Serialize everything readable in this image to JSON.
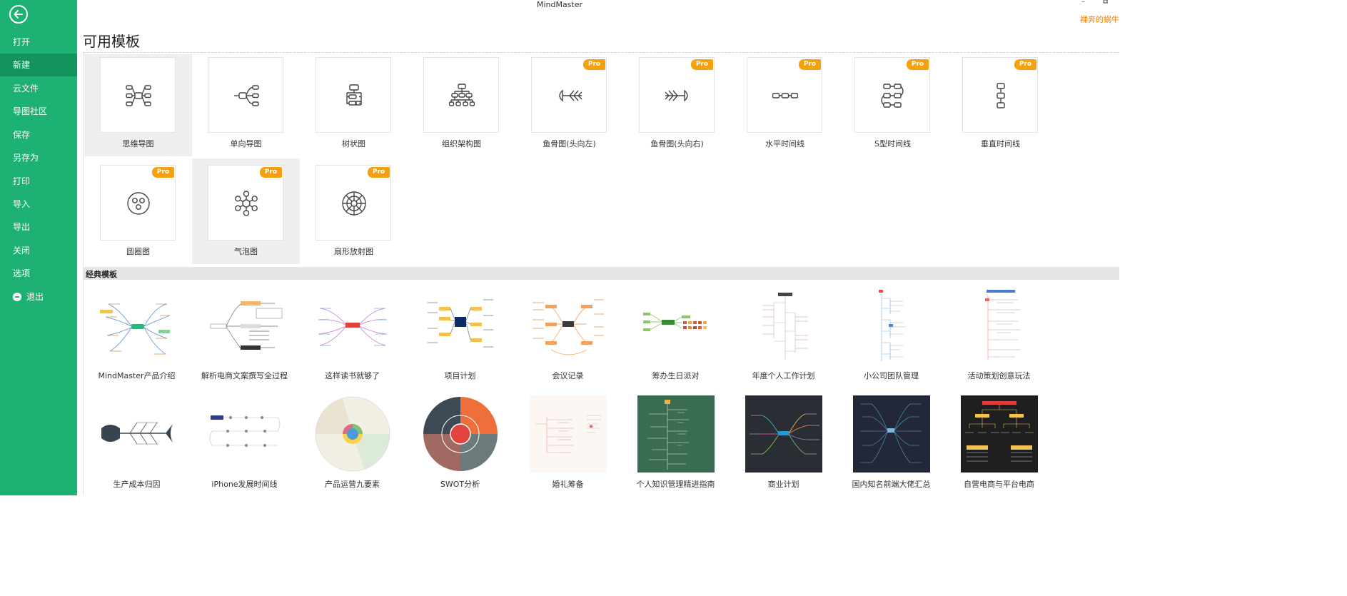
{
  "app": {
    "title": "MindMaster",
    "minimize": "–",
    "restore": "⧉",
    "user": "裸奔的蜗牛"
  },
  "sidebar": {
    "items": [
      {
        "label": "打开"
      },
      {
        "label": "新建"
      },
      {
        "label": "云文件"
      },
      {
        "label": "导图社区"
      },
      {
        "label": "保存"
      },
      {
        "label": "另存为"
      },
      {
        "label": "打印"
      },
      {
        "label": "导入"
      },
      {
        "label": "导出"
      },
      {
        "label": "关闭"
      },
      {
        "label": "选项"
      },
      {
        "label": "退出"
      }
    ],
    "active": "新建"
  },
  "page_title": "可用模板",
  "available_templates": [
    {
      "label": "思维导图",
      "pro": false,
      "icon": "mindmap-icon"
    },
    {
      "label": "单向导图",
      "pro": false,
      "icon": "right-map-icon"
    },
    {
      "label": "树状图",
      "pro": false,
      "icon": "tree-icon"
    },
    {
      "label": "组织架构图",
      "pro": false,
      "icon": "org-chart-icon"
    },
    {
      "label": "鱼骨图(头向左)",
      "pro": true,
      "icon": "fishbone-left-icon"
    },
    {
      "label": "鱼骨图(头向右)",
      "pro": true,
      "icon": "fishbone-right-icon"
    },
    {
      "label": "水平时间线",
      "pro": true,
      "icon": "horizontal-timeline-icon"
    },
    {
      "label": "S型时间线",
      "pro": true,
      "icon": "s-timeline-icon"
    },
    {
      "label": "垂直时间线",
      "pro": true,
      "icon": "vertical-timeline-icon"
    },
    {
      "label": "圆圈图",
      "pro": true,
      "icon": "circle-icon"
    },
    {
      "label": "气泡图",
      "pro": true,
      "icon": "bubble-icon"
    },
    {
      "label": "扇形放射图",
      "pro": true,
      "icon": "sector-icon"
    }
  ],
  "pro_badge": "Pro",
  "section_title": "经典模板",
  "classic_templates": [
    {
      "label": "MindMaster产品介绍",
      "bg": "#ffffff"
    },
    {
      "label": "解析电商文案撰写全过程",
      "bg": "#ffffff"
    },
    {
      "label": "这样读书就够了",
      "bg": "#ffffff"
    },
    {
      "label": "项目计划",
      "bg": "#ffffff"
    },
    {
      "label": "会议记录",
      "bg": "#ffffff"
    },
    {
      "label": "筹办生日派对",
      "bg": "#ffffff"
    },
    {
      "label": "年度个人工作计划",
      "bg": "#ffffff"
    },
    {
      "label": "小公司团队管理",
      "bg": "#ffffff"
    },
    {
      "label": "活动策划创意玩法",
      "bg": "#ffffff"
    },
    {
      "label": "生产成本归因",
      "bg": "#ffffff"
    },
    {
      "label": "iPhone发展时间线",
      "bg": "#ffffff"
    },
    {
      "label": "产品运营九要素",
      "bg": "#ffffff"
    },
    {
      "label": "SWOT分析",
      "bg": "#ffffff"
    },
    {
      "label": "婚礼筹备",
      "bg": "#fdf7f3"
    },
    {
      "label": "个人知识管理精进指南",
      "bg": "#3a6b53"
    },
    {
      "label": "商业计划",
      "bg": "#2b2d35"
    },
    {
      "label": "国内知名前端大佬汇总",
      "bg": "#232838"
    },
    {
      "label": "自营电商与平台电商",
      "bg": "#1f1f1f"
    }
  ]
}
